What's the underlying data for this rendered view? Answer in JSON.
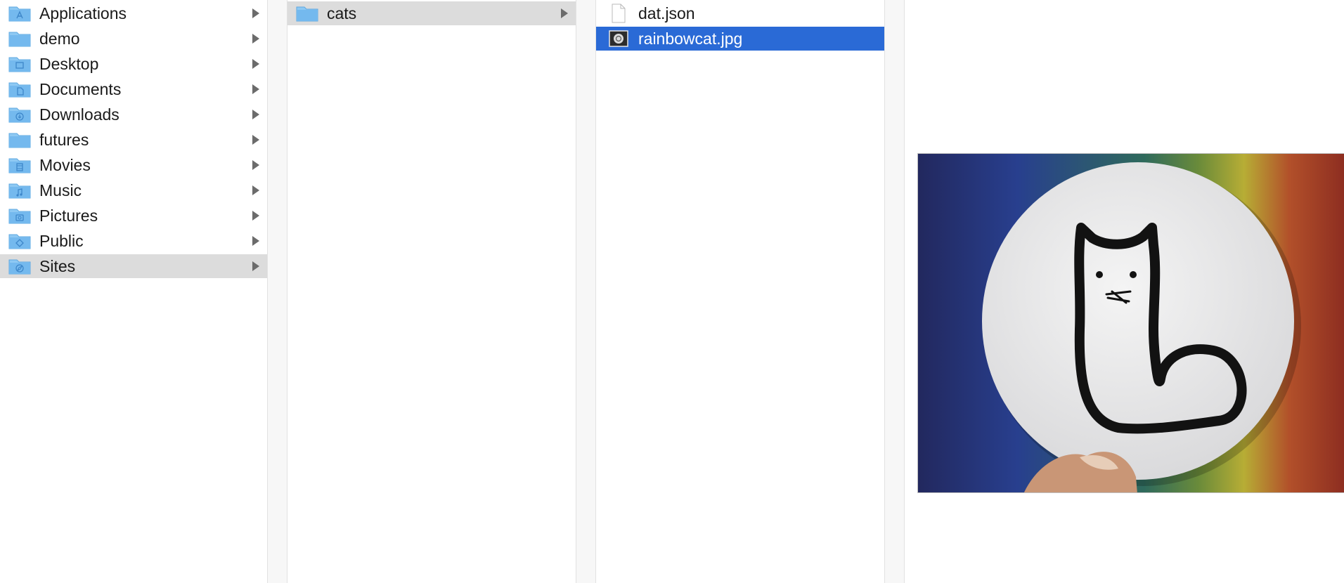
{
  "column1": {
    "items": [
      {
        "label": "Applications",
        "icon": "folder-applications-icon"
      },
      {
        "label": "demo",
        "icon": "folder-icon"
      },
      {
        "label": "Desktop",
        "icon": "folder-desktop-icon"
      },
      {
        "label": "Documents",
        "icon": "folder-documents-icon"
      },
      {
        "label": "Downloads",
        "icon": "folder-downloads-icon"
      },
      {
        "label": "futures",
        "icon": "folder-icon"
      },
      {
        "label": "Movies",
        "icon": "folder-movies-icon"
      },
      {
        "label": "Music",
        "icon": "folder-music-icon"
      },
      {
        "label": "Pictures",
        "icon": "folder-pictures-icon"
      },
      {
        "label": "Public",
        "icon": "folder-public-icon"
      },
      {
        "label": "Sites",
        "icon": "folder-sites-icon"
      }
    ],
    "selected_index": 10
  },
  "column2": {
    "items": [
      {
        "label": "cats",
        "icon": "folder-icon"
      }
    ],
    "selected_index": 0
  },
  "column3": {
    "items": [
      {
        "label": "dat.json",
        "icon": "document-icon"
      },
      {
        "label": "rainbowcat.jpg",
        "icon": "image-file-icon"
      }
    ],
    "selected_index": 1
  },
  "colors": {
    "selection_active": "#2a6ad6",
    "selection_inactive": "#dcdcdc",
    "folder_blue": "#6fb8ee"
  }
}
